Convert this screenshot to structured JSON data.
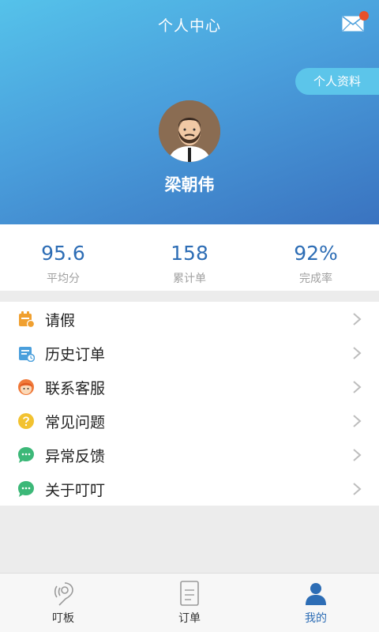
{
  "header": {
    "title": "个人中心",
    "profile_button": "个人资料",
    "username": "梁朝伟",
    "mail_icon": "mail-icon",
    "has_notification": true,
    "gradient_colors": [
      "#55c2ea",
      "#3a73c0"
    ]
  },
  "stats": [
    {
      "value": "95.6",
      "label": "平均分"
    },
    {
      "value": "158",
      "label": "累计单"
    },
    {
      "value": "92%",
      "label": "完成率"
    }
  ],
  "menu": [
    {
      "label": "请假",
      "icon": "leave-calendar-icon",
      "color": "#f0a030"
    },
    {
      "label": "历史订单",
      "icon": "history-order-icon",
      "color": "#4a9fdc"
    },
    {
      "label": "联系客服",
      "icon": "customer-service-icon",
      "color": "#f07a3a"
    },
    {
      "label": "常见问题",
      "icon": "question-icon",
      "color": "#f2c230"
    },
    {
      "label": "异常反馈",
      "icon": "feedback-chat-icon",
      "color": "#3cb878"
    },
    {
      "label": "关于叮叮",
      "icon": "about-chat-icon",
      "color": "#3cb878"
    }
  ],
  "tabbar": [
    {
      "label": "叮板",
      "icon": "location-pin-icon",
      "active": false
    },
    {
      "label": "订单",
      "icon": "order-document-icon",
      "active": false
    },
    {
      "label": "我的",
      "icon": "user-profile-icon",
      "active": true
    }
  ],
  "accent_color": "#2d6db5"
}
